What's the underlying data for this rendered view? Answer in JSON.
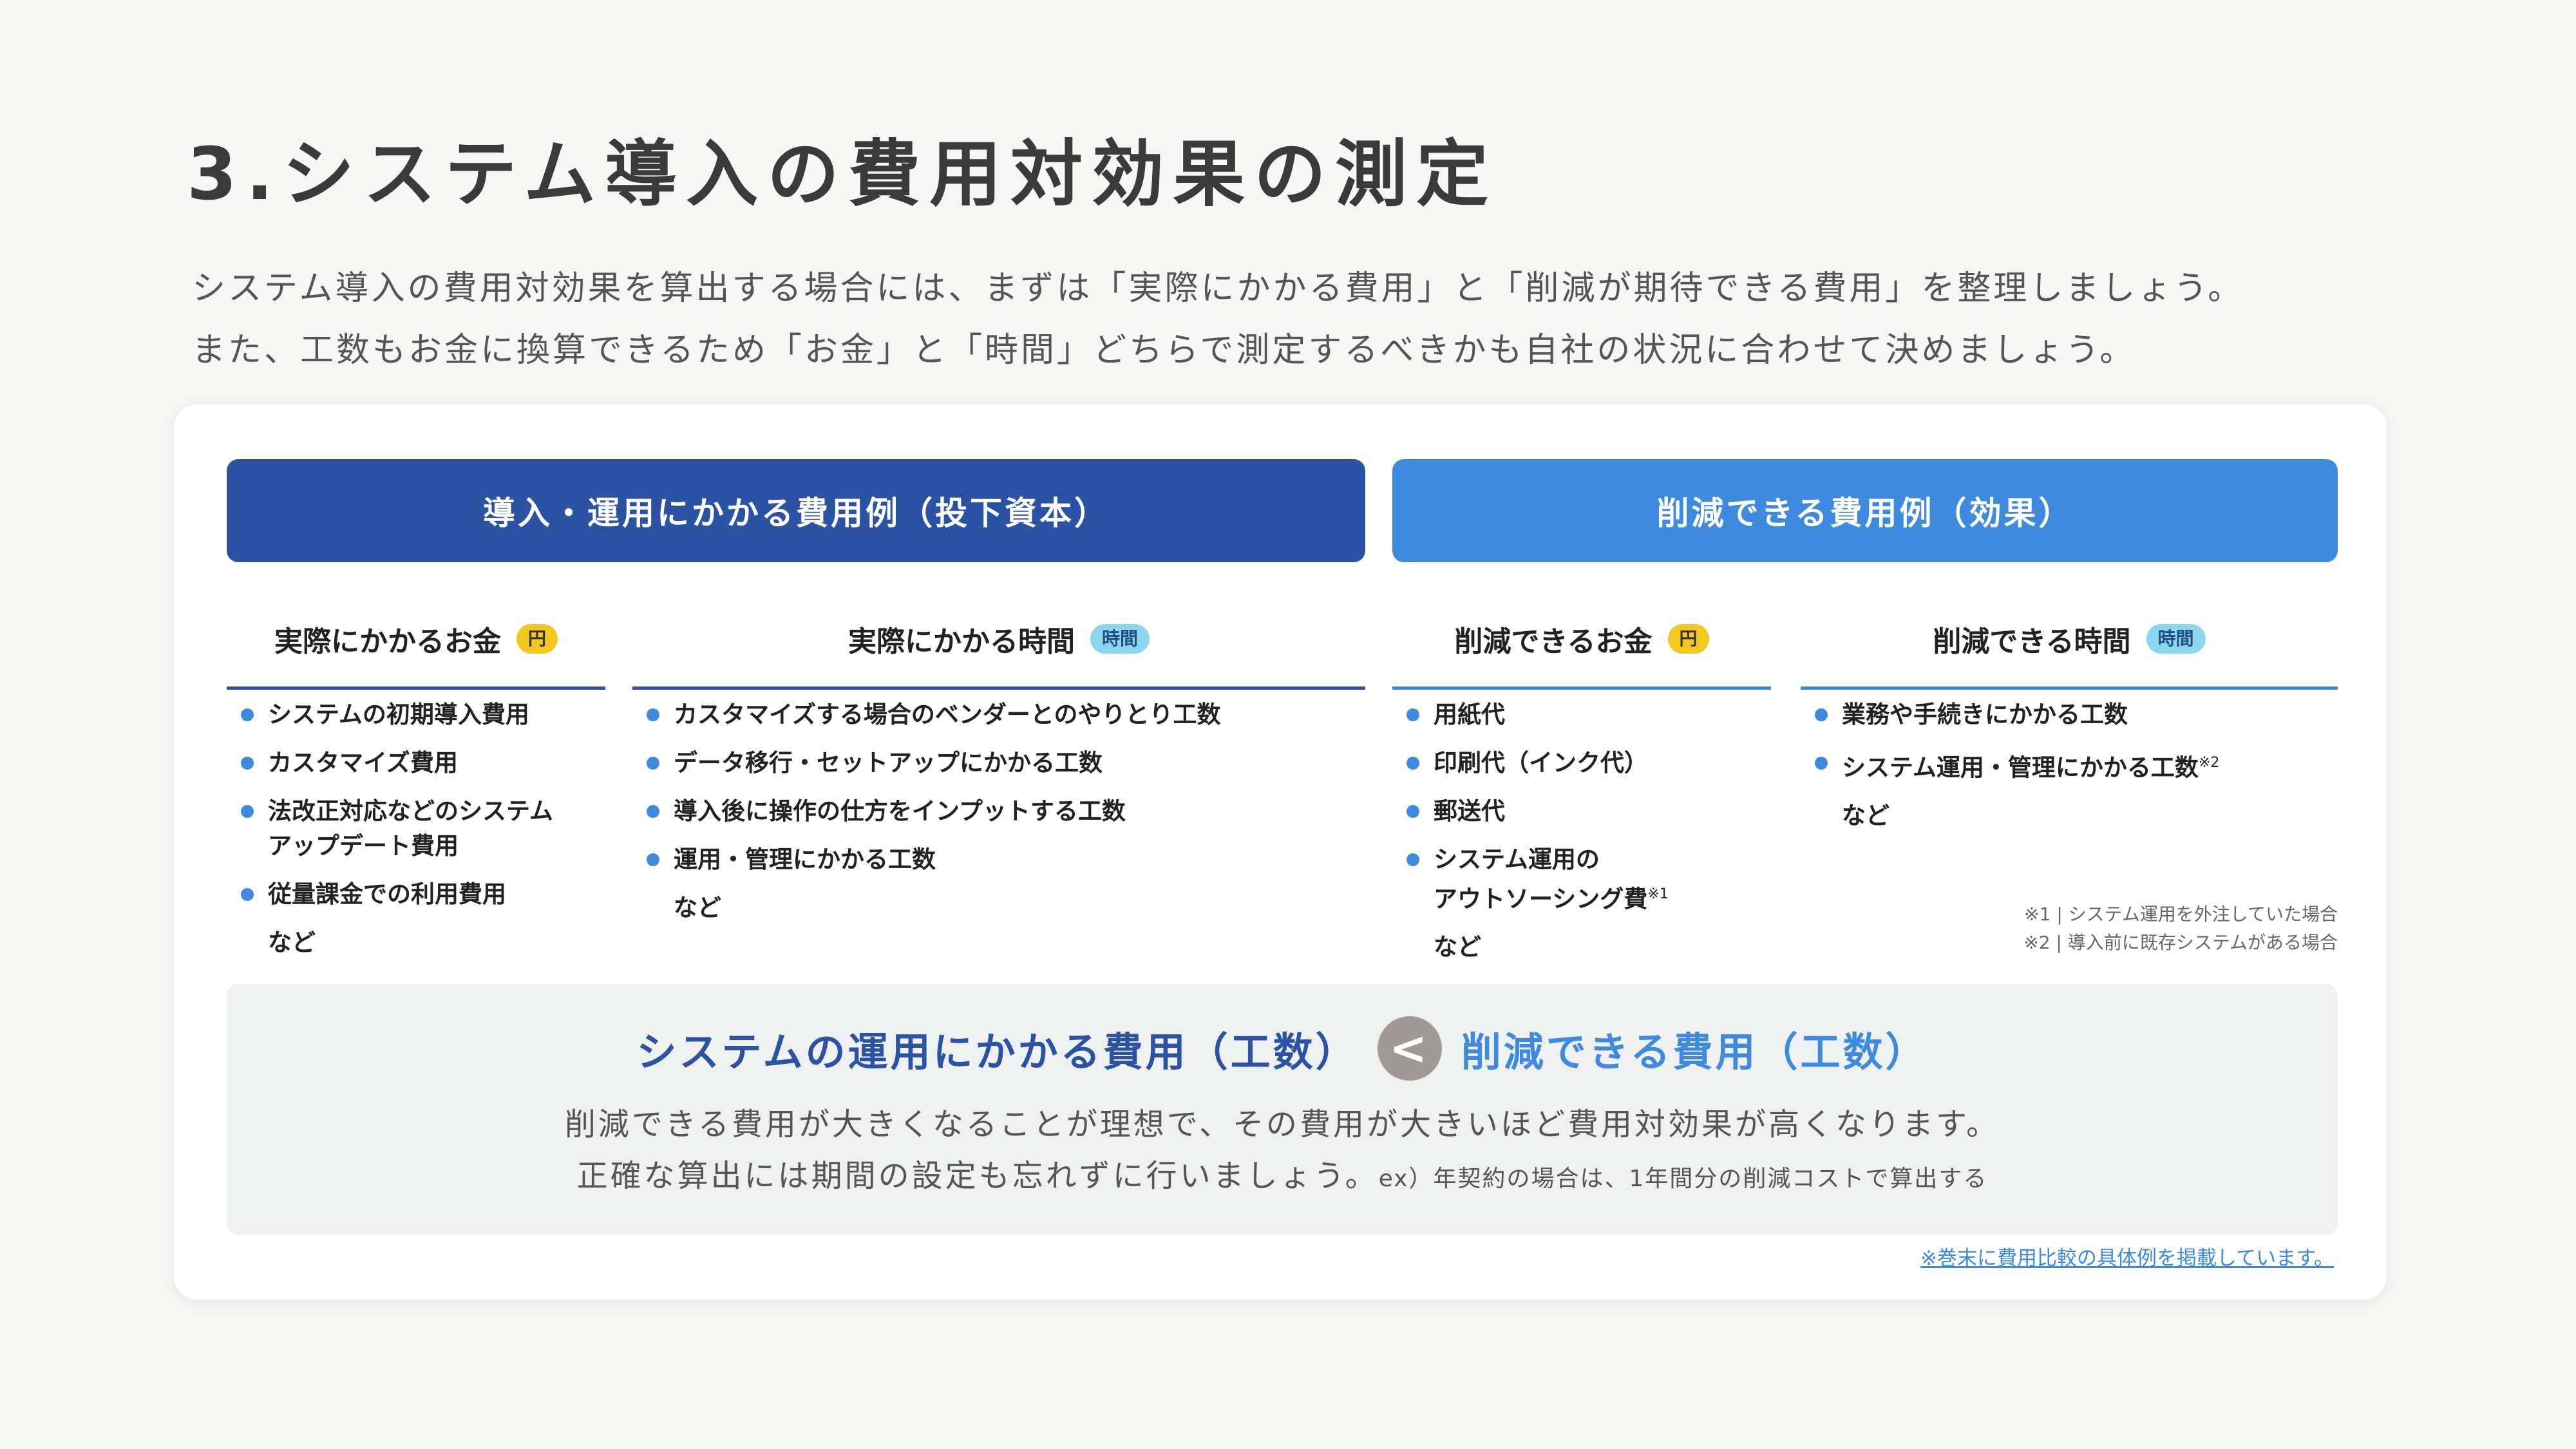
{
  "title": "3.システム導入の費用対効果の測定",
  "intro": {
    "line1": "システム導入の費用対効果を算出する場合には、まずは「実際にかかる費用」と「削減が期待できる費用」を整理しましょう。",
    "line2": "また、工数もお金に換算できるため「お金」と「時間」どちらで測定するべきかも自社の状況に合わせて決めましょう。"
  },
  "headers": {
    "invest": "導入・運用にかかる費用例（投下資本）",
    "effect": "削減できる費用例（効果）"
  },
  "columns": [
    {
      "title": "実際にかかるお金",
      "badge": "円",
      "items": [
        "システムの初期導入費用",
        "カスタマイズ費用",
        "法改正対応などのシステム\nアップデート費用",
        "従量課金での利用費用"
      ],
      "etc": "など"
    },
    {
      "title": "実際にかかる時間",
      "badge": "時間",
      "items": [
        "カスタマイズする場合のベンダーとのやりとり工数",
        "データ移行・セットアップにかかる工数",
        "導入後に操作の仕方をインプットする工数",
        "運用・管理にかかる工数"
      ],
      "etc": "など"
    },
    {
      "title": "削減できるお金",
      "badge": "円",
      "items": [
        "用紙代",
        "印刷代（インク代）",
        "郵送代",
        "システム運用の\nアウトソーシング費"
      ],
      "item4_sup": "※1",
      "etc": "など"
    },
    {
      "title": "削減できる時間",
      "badge": "時間",
      "items": [
        "業務や手続きにかかる工数",
        "システム運用・管理にかかる工数"
      ],
      "item2_sup": "※2",
      "etc": "など"
    }
  ],
  "notes": {
    "n1": "※1 | システム運用を外注していた場合",
    "n2": "※2 | 導入前に既存システムがある場合"
  },
  "summary": {
    "left": "システムの運用にかかる費用（工数）",
    "operator": "<",
    "right": "削減できる費用（工数）",
    "line1": "削減できる費用が大きくなることが理想で、その費用が大きいほど費用対効果が高くなります。",
    "line2": "正確な算出には期間の設定も忘れずに行いましょう。",
    "line2_small": "ex）年契約の場合は、1年間分の削減コストで算出する"
  },
  "footnote": "※巻末に費用比較の具体例を掲載しています。",
  "colors": {
    "dark_blue": "#2c53a3",
    "light_blue": "#3e8adf",
    "yen_badge": "#f3c622",
    "time_badge": "#8cd6ef"
  }
}
